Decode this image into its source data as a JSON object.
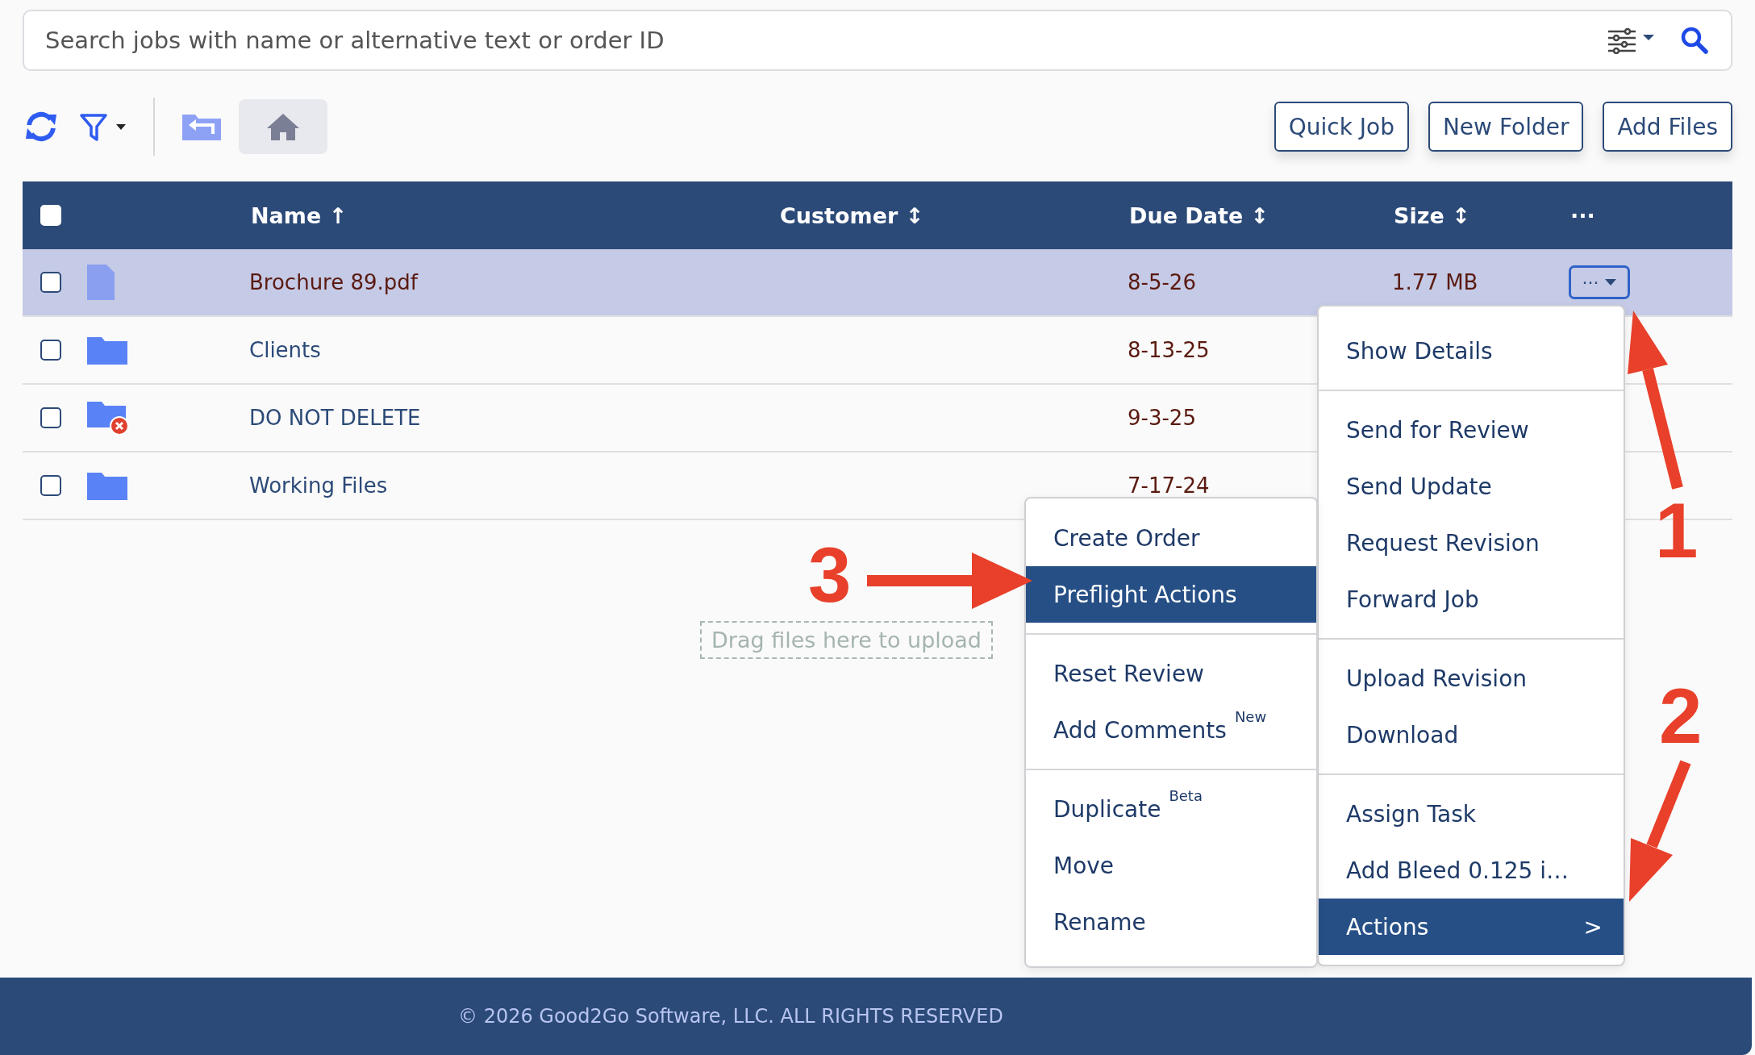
{
  "search": {
    "placeholder": "Search jobs with name or alternative text or order ID"
  },
  "toolbar": {
    "buttons": [
      "Quick Job",
      "New Folder",
      "Add Files"
    ]
  },
  "table": {
    "header_checkbox": {
      "checked": false
    },
    "columns": [
      {
        "label": "Name",
        "sort_indicator": "↑"
      },
      {
        "label": "Customer",
        "sort_indicator": "↕"
      },
      {
        "label": "Due Date",
        "sort_indicator": "↕"
      },
      {
        "label": "Size",
        "sort_indicator": "↕"
      }
    ],
    "actions_column": "···",
    "rows": [
      {
        "kind": "file",
        "name": "Brochure 89.pdf",
        "customer": "",
        "due": "8-5-26",
        "size": "1.77 MB",
        "selected": true,
        "checked": false,
        "menu_button": "···"
      },
      {
        "kind": "folder",
        "name": "Clients",
        "due": "8-13-25",
        "size": "",
        "selected": false,
        "checked": false
      },
      {
        "kind": "folder-blocked",
        "name": "DO NOT DELETE",
        "due": "9-3-25",
        "size": "",
        "selected": false,
        "checked": false
      },
      {
        "kind": "folder",
        "name": "Working Files",
        "due": "7-17-24",
        "size": "",
        "selected": false,
        "checked": false
      }
    ]
  },
  "drop_zone": "Drag files here to upload",
  "context_menu": {
    "groups": [
      [
        {
          "label": "Show Details",
          "selected": false
        }
      ],
      [
        {
          "label": "Send for Review",
          "selected": false
        },
        {
          "label": "Send Update",
          "selected": false
        },
        {
          "label": "Request Revision",
          "selected": false
        },
        {
          "label": "Forward Job",
          "selected": false
        }
      ],
      [
        {
          "label": "Upload Revision",
          "selected": false
        },
        {
          "label": "Download",
          "selected": false
        }
      ],
      [
        {
          "label": "Assign Task",
          "selected": false
        },
        {
          "label": "Add Bleed 0.125 i…",
          "selected": false
        },
        {
          "label": "Actions",
          "selected": true,
          "submenu_mark": ">"
        }
      ]
    ]
  },
  "submenu": {
    "groups": [
      [
        {
          "label": "Create Order",
          "selected": false
        },
        {
          "label": "Preflight Actions",
          "selected": true
        }
      ],
      [
        {
          "label": "Reset Review",
          "selected": false
        },
        {
          "label": "Add Comments",
          "badge": "New",
          "selected": false
        }
      ],
      [
        {
          "label": "Duplicate",
          "badge": "Beta",
          "selected": false
        },
        {
          "label": "Move",
          "selected": false
        },
        {
          "label": "Rename",
          "selected": false
        }
      ]
    ]
  },
  "annotations": [
    {
      "label": "1"
    },
    {
      "label": "2"
    },
    {
      "label": "3"
    }
  ],
  "footer": "© 2026 Good2Go Software, LLC. ALL RIGHTS RESERVED"
}
